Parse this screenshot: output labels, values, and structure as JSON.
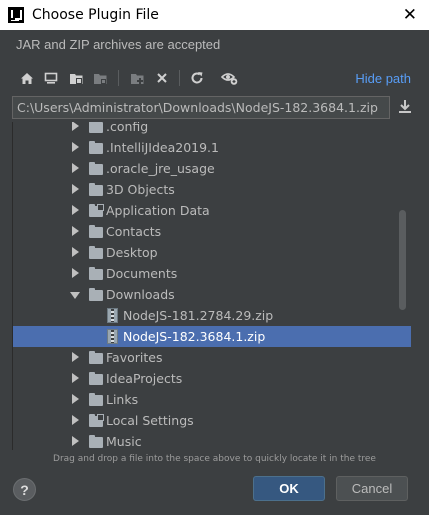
{
  "window": {
    "title": "Choose Plugin File",
    "close_glyph": "✕"
  },
  "description": "JAR and ZIP archives are accepted",
  "toolbar": {
    "icons": [
      "home-icon",
      "desktop-icon",
      "project-folder-icon",
      "module-folder-icon",
      "new-folder-icon",
      "delete-icon",
      "refresh-icon",
      "show-hidden-icon"
    ],
    "hide_path_label": "Hide path"
  },
  "path": {
    "value": "C:\\Users\\Administrator\\Downloads\\NodeJS-182.3684.1.zip"
  },
  "tree": {
    "rows": [
      {
        "label": ".config",
        "kind": "folder",
        "expanded": false,
        "depth": 1
      },
      {
        "label": ".IntelliJIdea2019.1",
        "kind": "folder",
        "expanded": false,
        "depth": 1
      },
      {
        "label": ".oracle_jre_usage",
        "kind": "folder",
        "expanded": false,
        "depth": 1
      },
      {
        "label": "3D Objects",
        "kind": "folder",
        "expanded": false,
        "depth": 1
      },
      {
        "label": "Application Data",
        "kind": "folder-link",
        "expanded": false,
        "depth": 1
      },
      {
        "label": "Contacts",
        "kind": "folder",
        "expanded": false,
        "depth": 1
      },
      {
        "label": "Desktop",
        "kind": "folder",
        "expanded": false,
        "depth": 1
      },
      {
        "label": "Documents",
        "kind": "folder",
        "expanded": false,
        "depth": 1
      },
      {
        "label": "Downloads",
        "kind": "folder",
        "expanded": true,
        "depth": 1
      },
      {
        "label": "NodeJS-181.2784.29.zip",
        "kind": "zip",
        "depth": 2
      },
      {
        "label": "NodeJS-182.3684.1.zip",
        "kind": "zip",
        "depth": 2,
        "selected": true
      },
      {
        "label": "Favorites",
        "kind": "folder",
        "expanded": false,
        "depth": 1
      },
      {
        "label": "IdeaProjects",
        "kind": "folder",
        "expanded": false,
        "depth": 1
      },
      {
        "label": "Links",
        "kind": "folder",
        "expanded": false,
        "depth": 1
      },
      {
        "label": "Local Settings",
        "kind": "folder-link",
        "expanded": false,
        "depth": 1
      },
      {
        "label": "Music",
        "kind": "folder",
        "expanded": false,
        "depth": 1
      }
    ]
  },
  "hint": "Drag and drop a file into the space above to quickly locate it in the tree",
  "buttons": {
    "help": "?",
    "ok": "OK",
    "cancel": "Cancel"
  },
  "colors": {
    "background": "#3c3f41",
    "selection": "#4b6eaf",
    "link": "#589df6",
    "ok_button": "#365880"
  }
}
